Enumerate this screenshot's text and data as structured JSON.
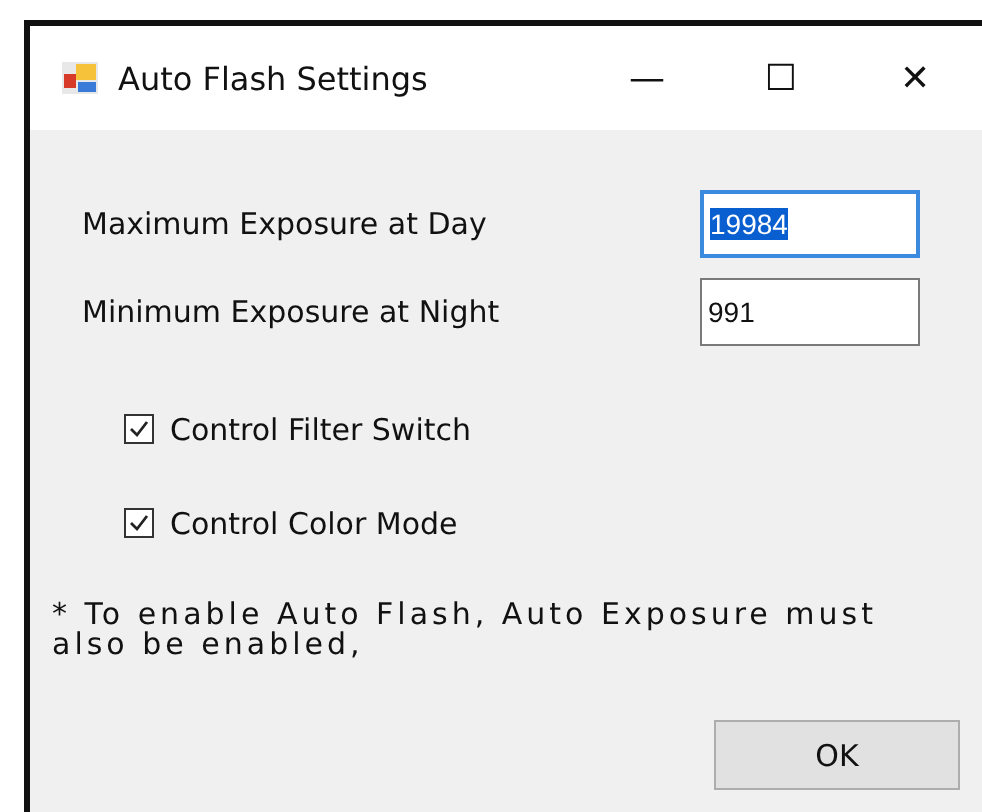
{
  "window": {
    "title": "Auto Flash Settings",
    "controls": [
      "—",
      "☐",
      "✕"
    ]
  },
  "fields": [
    {
      "label": "Maximum Exposure at Day",
      "value": "19984",
      "focused": true
    },
    {
      "label": "Minimum Exposure at Night",
      "value": "991",
      "focused": false
    }
  ],
  "checkboxes": [
    {
      "label": "Control Filter Switch",
      "checked": true
    },
    {
      "label": "Control Color Mode",
      "checked": true
    }
  ],
  "note": "* To enable Auto Flash, Auto Exposure must also be enabled,",
  "buttons": [
    "OK"
  ]
}
